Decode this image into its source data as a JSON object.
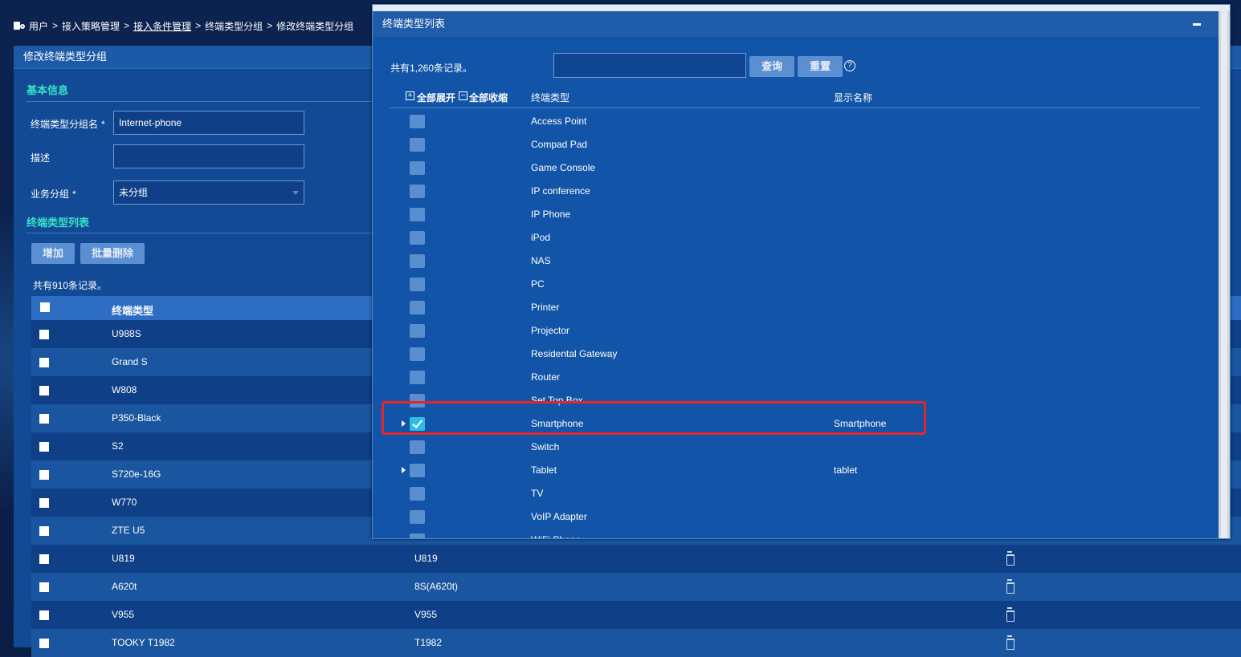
{
  "breadcrumb": {
    "items": [
      "用户",
      "接入策略管理",
      "接入条件管理",
      "终端类型分组",
      "修改终端类型分组"
    ],
    "separator": ">"
  },
  "panel": {
    "title": "修改终端类型分组",
    "basic_info_title": "基本信息",
    "fields": {
      "group_name_label": "终端类型分组名",
      "group_name_value": "Internet-phone",
      "required_mark": "*",
      "description_label": "描述",
      "description_value": "",
      "business_group_label": "业务分组",
      "business_group_value": "未分组"
    },
    "type_list_title": "终端类型列表",
    "add_button": "增加",
    "batch_delete_button": "批量删除",
    "record_count": "共有910条记录。",
    "table_header": "终端类型",
    "rows": [
      {
        "type": "U988S",
        "display": ""
      },
      {
        "type": "Grand S",
        "display": ""
      },
      {
        "type": "W808",
        "display": ""
      },
      {
        "type": "P350-Black",
        "display": ""
      },
      {
        "type": "S2",
        "display": ""
      },
      {
        "type": "S720e-16G",
        "display": ""
      },
      {
        "type": "W770",
        "display": ""
      },
      {
        "type": "ZTE U5",
        "display": ""
      },
      {
        "type": "U819",
        "display": "U819"
      },
      {
        "type": "A620t",
        "display": "8S(A620t)"
      },
      {
        "type": "V955",
        "display": "V955"
      },
      {
        "type": "TOOKY T1982",
        "display": "T1982"
      }
    ]
  },
  "dialog": {
    "title": "终端类型列表",
    "record_count": "共有1,260条记录。",
    "search_value": "",
    "query_button": "查询",
    "reset_button": "重置",
    "help": "?",
    "expand_all": "全部展开",
    "collapse_all": "全部收缩",
    "col_type": "终端类型",
    "col_display": "显示名称",
    "items": [
      {
        "name": "Access Point",
        "display": "",
        "expandable": false,
        "checked": false
      },
      {
        "name": "Compad Pad",
        "display": "",
        "expandable": false,
        "checked": false
      },
      {
        "name": "Game Console",
        "display": "",
        "expandable": false,
        "checked": false
      },
      {
        "name": "IP conference",
        "display": "",
        "expandable": false,
        "checked": false
      },
      {
        "name": "IP Phone",
        "display": "",
        "expandable": false,
        "checked": false
      },
      {
        "name": "iPod",
        "display": "",
        "expandable": false,
        "checked": false
      },
      {
        "name": "NAS",
        "display": "",
        "expandable": false,
        "checked": false
      },
      {
        "name": "PC",
        "display": "",
        "expandable": false,
        "checked": false
      },
      {
        "name": "Printer",
        "display": "",
        "expandable": false,
        "checked": false
      },
      {
        "name": "Projector",
        "display": "",
        "expandable": false,
        "checked": false
      },
      {
        "name": "Residental Gateway",
        "display": "",
        "expandable": false,
        "checked": false
      },
      {
        "name": "Router",
        "display": "",
        "expandable": false,
        "checked": false
      },
      {
        "name": "Set Top Box",
        "display": "",
        "expandable": false,
        "checked": false
      },
      {
        "name": "Smartphone",
        "display": "Smartphone",
        "expandable": true,
        "checked": true
      },
      {
        "name": "Switch",
        "display": "",
        "expandable": false,
        "checked": false
      },
      {
        "name": "Tablet",
        "display": "tablet",
        "expandable": true,
        "checked": false
      },
      {
        "name": "TV",
        "display": "",
        "expandable": false,
        "checked": false
      },
      {
        "name": "VoIP Adapter",
        "display": "",
        "expandable": false,
        "checked": false
      },
      {
        "name": "WiFi Phone",
        "display": "",
        "expandable": false,
        "checked": false
      }
    ]
  },
  "colors": {
    "accent_title": "#38e3c8",
    "highlight_border": "#e4262a",
    "button": "#5b8fd1",
    "checked_box": "#2dbbe8"
  }
}
